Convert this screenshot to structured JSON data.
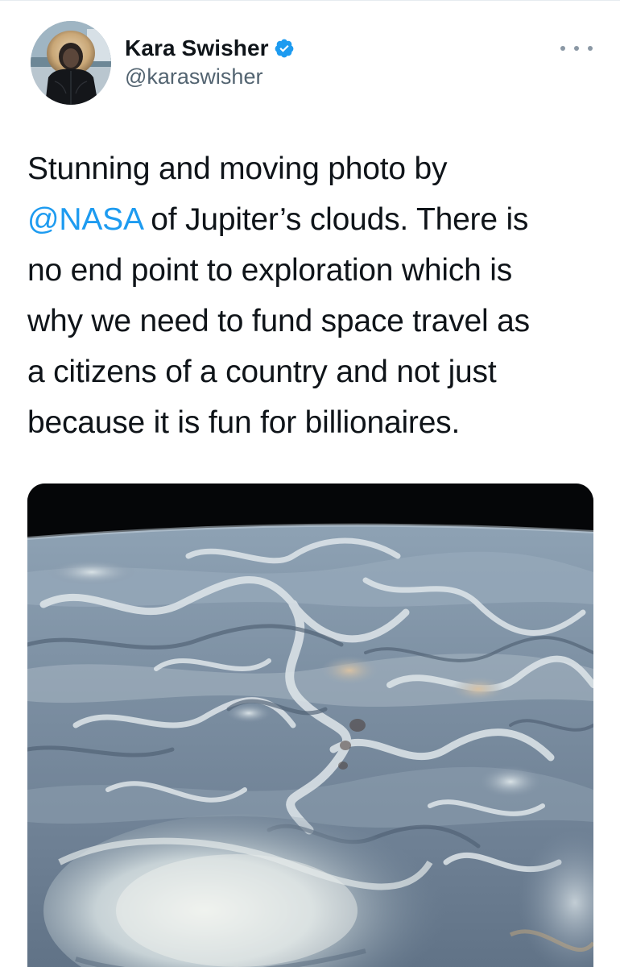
{
  "author": {
    "display_name": "Kara Swisher",
    "handle": "@karaswisher",
    "verified": true,
    "verified_icon": "verified-badge-icon",
    "avatar": "profile-photo-fur-hood"
  },
  "more_icon": "more-options-icon",
  "tweet": {
    "line1": "Stunning and moving photo by",
    "mention": "@NASA",
    "line2_rest": " of Jupiter’s clouds. There is",
    "line3": "no end point to exploration which is",
    "line4": "why we need to fund space travel as",
    "line5": "a citizens of a country and not just",
    "line6": "because it is fun for billionaires."
  },
  "media": {
    "subject": "Jupiter cloud swirls photo"
  },
  "colors": {
    "link": "#1d9bf0",
    "text": "#0f1419",
    "secondary": "#536471",
    "verified": "#1d9bf0"
  }
}
